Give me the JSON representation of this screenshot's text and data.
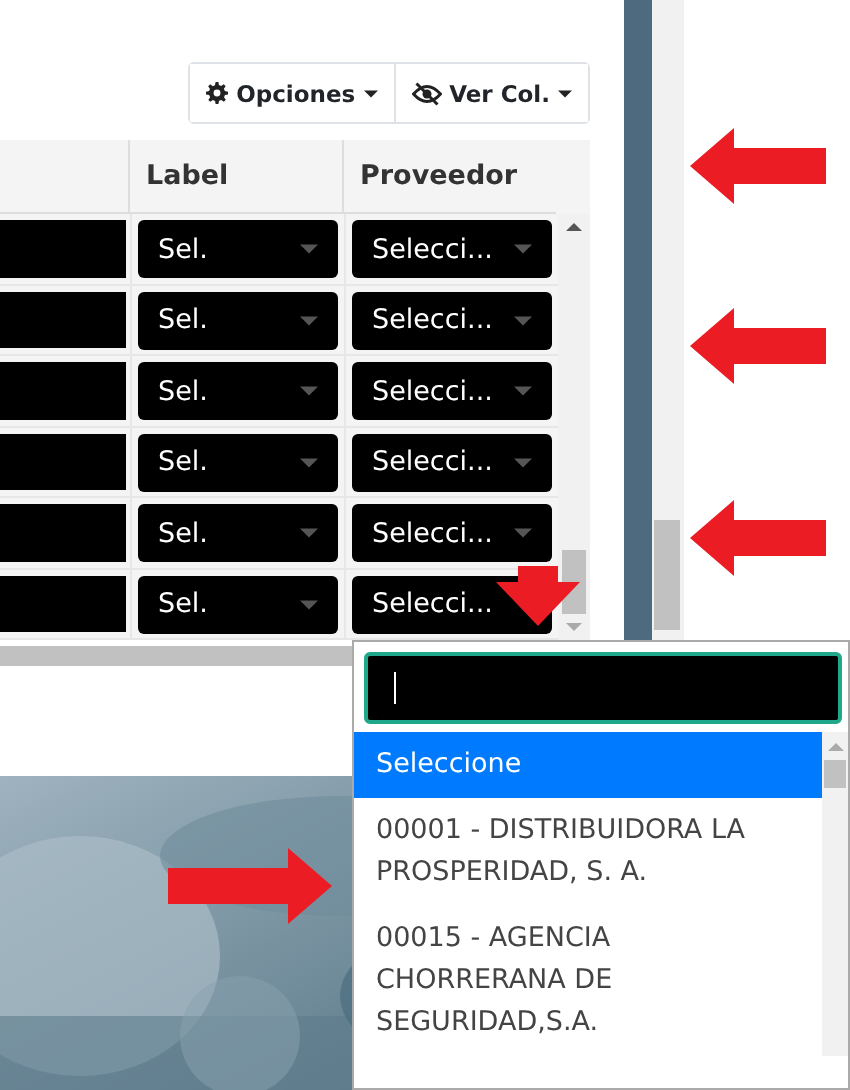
{
  "toolbar": {
    "buttons": [
      {
        "kind": "gear",
        "label": "Opciones"
      },
      {
        "kind": "eye-slash",
        "label": "Ver Col."
      }
    ]
  },
  "table": {
    "columns": [
      {
        "label": "Label"
      },
      {
        "label": "Proveedor"
      }
    ],
    "rows": [
      {
        "label": "Sel.",
        "proveedor": "Selecci..."
      },
      {
        "label": "Sel.",
        "proveedor": "Selecci..."
      },
      {
        "label": "Sel.",
        "proveedor": "Selecci..."
      },
      {
        "label": "Sel.",
        "proveedor": "Selecci..."
      },
      {
        "label": "Sel.",
        "proveedor": "Selecci..."
      },
      {
        "label": "Sel.",
        "proveedor": "Selecci..."
      }
    ]
  },
  "dropdown": {
    "options": [
      {
        "text": "Seleccione",
        "selected": true
      },
      {
        "text": "00001 - DISTRIBUIDORA LA PROSPERIDAD, S. A.",
        "selected": false
      },
      {
        "text": "00015 - AGENCIA CHORRERANA DE SEGURIDAD,S.A.",
        "selected": false
      }
    ]
  }
}
